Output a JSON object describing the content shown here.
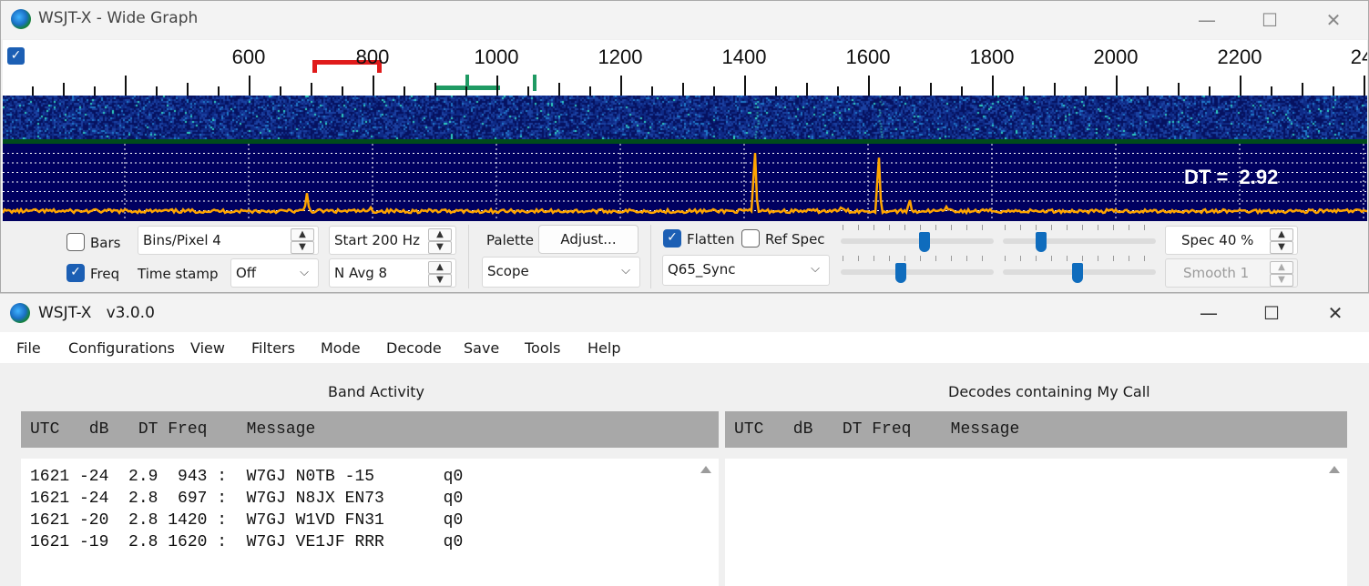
{
  "wide_graph": {
    "title": "WSJT-X - Wide Graph",
    "scale_labels": [
      "600",
      "800",
      "1000",
      "1200",
      "1400",
      "1600",
      "1800",
      "2000",
      "2200",
      "24"
    ],
    "dt_label": "DT =  2.92",
    "controls": {
      "bars_label": "Bars",
      "bars_checked": false,
      "freq_label": "Freq",
      "freq_checked": true,
      "bins_pixel": "Bins/Pixel  4",
      "timestamp_label": "Time stamp",
      "timestamp_value": "Off",
      "start": "Start 200 Hz",
      "navg": "N Avg 8",
      "palette_label": "Palette",
      "adjust_button": "Adjust...",
      "palette_value": "Scope",
      "flatten_label": "Flatten",
      "flatten_checked": true,
      "refspec_label": "Ref Spec",
      "refspec_checked": false,
      "mode_value": "Q65_Sync",
      "spec": "Spec 40 %",
      "smooth": "Smooth  1",
      "slider_levels": [
        0.55,
        0.25,
        0.4,
        0.5
      ]
    }
  },
  "main_window": {
    "title": "WSJT-X   v3.0.0",
    "menu": [
      "File",
      "Configurations",
      "View",
      "Filters",
      "Mode",
      "Decode",
      "Save",
      "Tools",
      "Help"
    ],
    "band_activity": {
      "title": "Band Activity",
      "header": "UTC   dB   DT Freq    Message",
      "lines": [
        "1621 -24  2.9  943 :  W7GJ N0TB -15       q0",
        "1621 -24  2.8  697 :  W7GJ N8JX EN73      q0",
        "1621 -20  2.8 1420 :  W7GJ W1VD FN31      q0",
        "1621 -19  2.8 1620 :  W7GJ VE1JF RRR      q0"
      ]
    },
    "my_call": {
      "title": "Decodes containing My Call",
      "header": "UTC   dB   DT Freq    Message",
      "lines": []
    }
  },
  "colors": {
    "spectrum_bg": "#000060",
    "spectrum_trace": "#ffa500",
    "header_gray": "#a8a8a8",
    "checkbox_blue": "#1c5fb4",
    "rx_marker": "#e01b1b",
    "tx_marker": "#1f9a63"
  }
}
